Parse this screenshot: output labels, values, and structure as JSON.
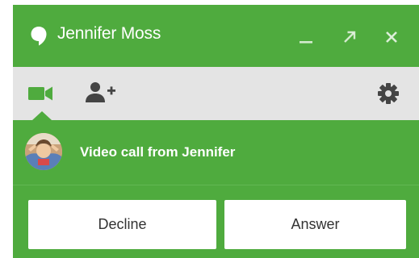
{
  "window": {
    "title": "Jennifer Moss",
    "icons": {
      "title": "chat-bubble-icon",
      "minimize": "minimize-icon",
      "popout": "pop-out-arrow-icon",
      "close": "close-icon"
    }
  },
  "toolbar": {
    "icons": [
      "video-camera-icon",
      "add-person-icon",
      "gear-icon"
    ]
  },
  "call_notice": {
    "text": "Video call from Jennifer"
  },
  "actions": {
    "decline_label": "Decline",
    "answer_label": "Answer"
  },
  "colors": {
    "brand_green": "#4fab3e",
    "toolbar_gray": "#e4e4e4",
    "icon_gray": "#444444",
    "button_text": "#333333"
  }
}
